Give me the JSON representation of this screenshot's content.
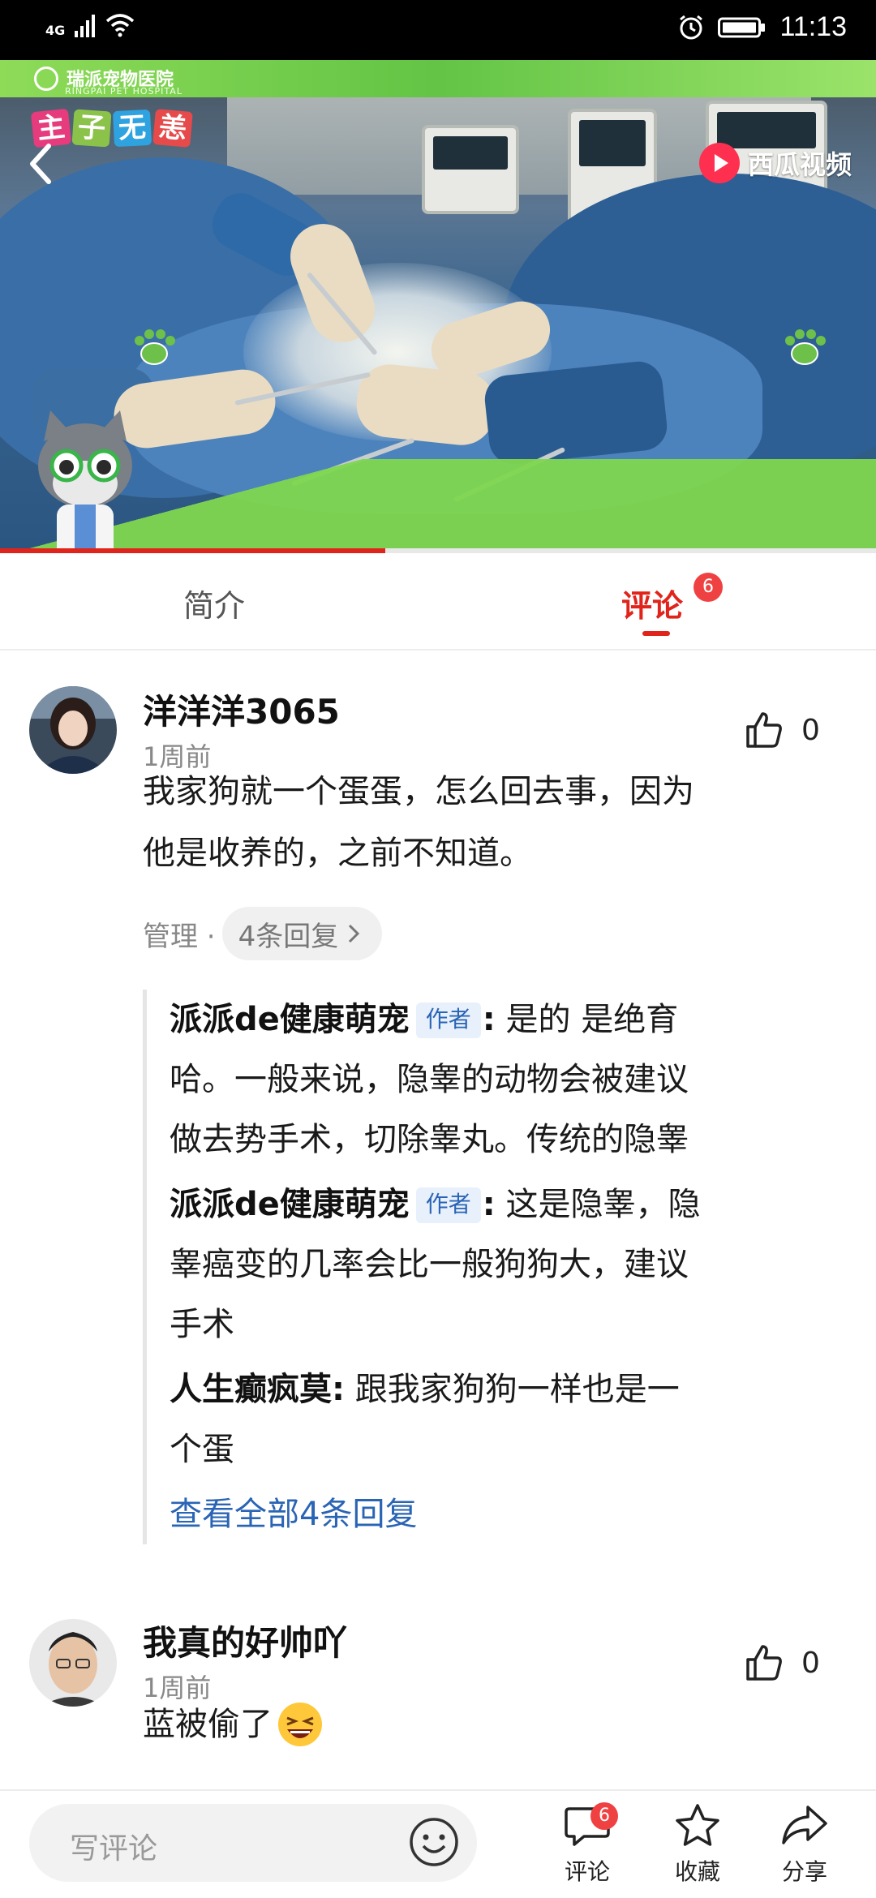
{
  "status_bar": {
    "network": "4G",
    "time": "11:13"
  },
  "video": {
    "logo_text": "瑞派宠物医院",
    "logo_sub": "RINGPAI PET HOSPITAL",
    "show_title": [
      "主",
      "子",
      "无",
      "恙"
    ],
    "platform": "西瓜视频",
    "progress": 0.44
  },
  "tabs": [
    {
      "label": "简介",
      "active": false
    },
    {
      "label": "评论",
      "active": true,
      "badge": "6"
    }
  ],
  "comments": [
    {
      "username": "洋洋洋3065",
      "time": "1周前",
      "likes": "0",
      "content_lines": [
        "我家狗就一个蛋蛋，怎么回去事，因为",
        "他是收养的，之前不知道。"
      ],
      "manage_label": "管理 ·",
      "reply_count_label": "4条回复",
      "replies": [
        {
          "author": "派派de健康萌宠",
          "tag": "作者",
          "colon": ":",
          "lines": [
            " 是的 是绝育",
            "哈。一般来说，隐睾的动物会被建议",
            "做去势手术，切除睾丸。传统的隐睾"
          ]
        },
        {
          "author": "派派de健康萌宠",
          "tag": "作者",
          "colon": ":",
          "lines": [
            " 这是隐睾，隐",
            "睾癌变的几率会比一般狗狗大，建议",
            "手术"
          ]
        },
        {
          "author": "人生癫疯莫",
          "tag": "",
          "colon": ":",
          "lines": [
            " 跟我家狗狗一样也是一",
            "个蛋"
          ]
        }
      ],
      "view_all": "查看全部4条回复"
    },
    {
      "username": "我真的好帅吖",
      "time": "1周前",
      "likes": "0",
      "content": "蓝被偷了"
    }
  ],
  "bottom_bar": {
    "placeholder": "写评论",
    "comment_label": "评论",
    "comment_badge": "6",
    "favorite_label": "收藏",
    "share_label": "分享"
  },
  "colors": {
    "accent": "#e0241b",
    "link": "#2a64b5",
    "badge": "#f04142"
  }
}
